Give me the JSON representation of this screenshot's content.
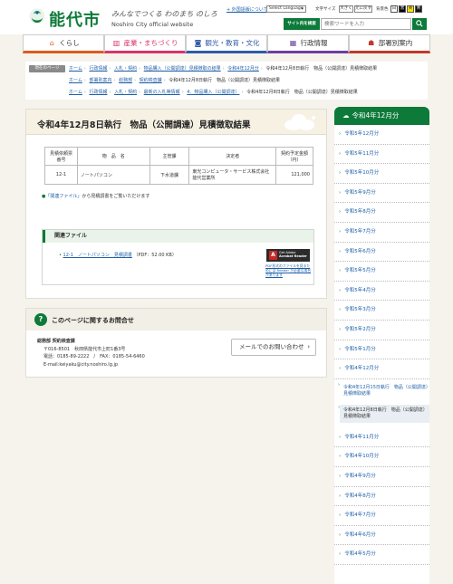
{
  "header": {
    "logo_name": "能代市",
    "catch_copy": "みんなでつくる わのまち のしろ",
    "catch_en": "Noshiro City official website",
    "link_foreign": "+ 外国語版について",
    "language_select": "Select Language",
    "font_size_label": "文字サイズ",
    "font_size_options": [
      "大きく",
      "元に戻す"
    ],
    "bg_label": "背景色",
    "bg_options": [
      "白",
      "黒",
      "黄",
      "青"
    ],
    "search_label": "サイト内を検索",
    "search_placeholder": "検索ワードを入力",
    "search_button": "Q"
  },
  "nav": [
    {
      "label": "くらし",
      "icon": "house-icon",
      "color": "#e05a1e"
    },
    {
      "label": "産業・まちづくり",
      "icon": "building-icon",
      "color": "#d9356b"
    },
    {
      "label": "観光・教育・文化",
      "icon": "camera-icon",
      "color": "#2f5aa8"
    },
    {
      "label": "行政情報",
      "icon": "grid-icon",
      "color": "#6b3fa0"
    },
    {
      "label": "部署別案内",
      "icon": "people-icon",
      "color": "#c0392b"
    }
  ],
  "breadcrumb": {
    "label": "現在のページ",
    "lines": [
      [
        "ホーム",
        "行政情報",
        "入札・契約",
        "物品購入（公開調達）見積徴取の結果",
        "令和4年12月分",
        "令和4年12月8日執行　物品（公開調達）見積徴取結果"
      ],
      [
        "ホーム",
        "部署別案内",
        "総務部",
        "契約検査課",
        "令和4年12月8日執行　物品（公開調達）見積徴取結果"
      ],
      [
        "ホーム",
        "行政情報",
        "入札・契約",
        "最新の入札等情報",
        "4．物品購入（公開調達）",
        "令和4年12月8日執行　物品（公開調達）見積徴取結果"
      ]
    ]
  },
  "main": {
    "title": "令和4年12月8日執行　物品（公開調達）見積徴取結果",
    "table": {
      "headers": [
        "見積依頼票番号",
        "物　品　名",
        "主管課",
        "決定者",
        "契約予定金額（円）"
      ],
      "rows": [
        [
          "12-1",
          "ノートパソコン",
          "下水道課",
          "東光コンピュータ・サービス株式会社　能代営業所",
          "121,000"
        ]
      ]
    },
    "note_link": "「関連ファイル」",
    "note_text": "から見積調書をご覧いただけます",
    "related": {
      "title": "関連ファイル",
      "file_link": "12-1　ノートパソコン　見積調書",
      "file_info": "（PDF：52.00 KB）",
      "adobe_badge_line1": "Get Adobe",
      "adobe_badge_line2": "Acrobat Reader",
      "adobe_note": "PDF形式のファイルを見るためには Reader が必要な場合があります"
    }
  },
  "contact": {
    "title": "このページに関するお問合せ",
    "dept": "総務部 契約検査課",
    "address": "〒016-8501　秋田県能代市上町1番3号",
    "tel": "電話：0185-89-2222　/　FAX：0185-54-6460",
    "email": "E-mail:keiyaku@city.noshiro.lg.jp",
    "mail_button": "メールでのお問い合わせ"
  },
  "sidebar": {
    "title": "令和4年12月分",
    "items_top": [
      "令和5年12月分",
      "令和5年11月分",
      "令和5年10月分",
      "令和5年9月分",
      "令和5年8月分",
      "令和5年7月分",
      "令和5年6月分",
      "令和5年5月分",
      "令和5年4月分",
      "令和5年3月分",
      "令和5年2月分",
      "令和5年1月分",
      "令和4年12月分"
    ],
    "subs": [
      "令和4年12月15日執行　物品（公開調達）見積徴取結果",
      "令和4年12月8日執行　物品（公開調達）見積徴取結果"
    ],
    "items_bottom": [
      "令和4年11月分",
      "令和4年10月分",
      "令和4年9月分",
      "令和4年8月分",
      "令和4年7月分",
      "令和4年6月分",
      "令和4年5月分",
      "令和4年4月分"
    ]
  },
  "colors": {
    "brand": "#0d7a3a",
    "link": "#1f5fa8",
    "page_bg": "#f6f3ec"
  }
}
